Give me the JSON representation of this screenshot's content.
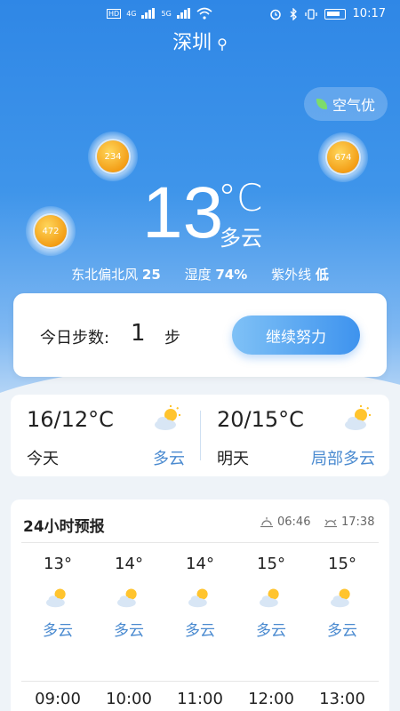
{
  "status_bar": {
    "time": "10:17",
    "net_labels": [
      "4G",
      "5G"
    ]
  },
  "city": "深圳",
  "air_quality": "空气优",
  "bubbles": [
    "234",
    "674",
    "472"
  ],
  "current": {
    "temperature": "13",
    "unit": "°C",
    "condition": "多云",
    "wind_label": "东北偏北风",
    "wind_value": "25",
    "humidity_label": "湿度",
    "humidity_value": "74%",
    "uv_label": "紫外线",
    "uv_value": "低"
  },
  "steps": {
    "label": "今日步数:",
    "value": "1",
    "unit": "步",
    "button": "继续努力"
  },
  "forecast": {
    "today": {
      "temps": "16/12°C",
      "day": "今天",
      "desc": "多云"
    },
    "tomorrow": {
      "temps": "20/15°C",
      "day": "明天",
      "desc": "局部多云"
    }
  },
  "hourly": {
    "title": "24小时预报",
    "sunrise": "06:46",
    "sunset": "17:38",
    "items": [
      {
        "temp": "13°",
        "cond": "多云",
        "time": "09:00"
      },
      {
        "temp": "14°",
        "cond": "多云",
        "time": "10:00"
      },
      {
        "temp": "14°",
        "cond": "多云",
        "time": "11:00"
      },
      {
        "temp": "15°",
        "cond": "多云",
        "time": "12:00"
      },
      {
        "temp": "15°",
        "cond": "多云",
        "time": "13:00"
      }
    ]
  },
  "colors": {
    "accent": "#3e93ee",
    "sky_top": "#2f87e6",
    "link": "#4a8ad0",
    "badge_orange": "#f29a12"
  }
}
